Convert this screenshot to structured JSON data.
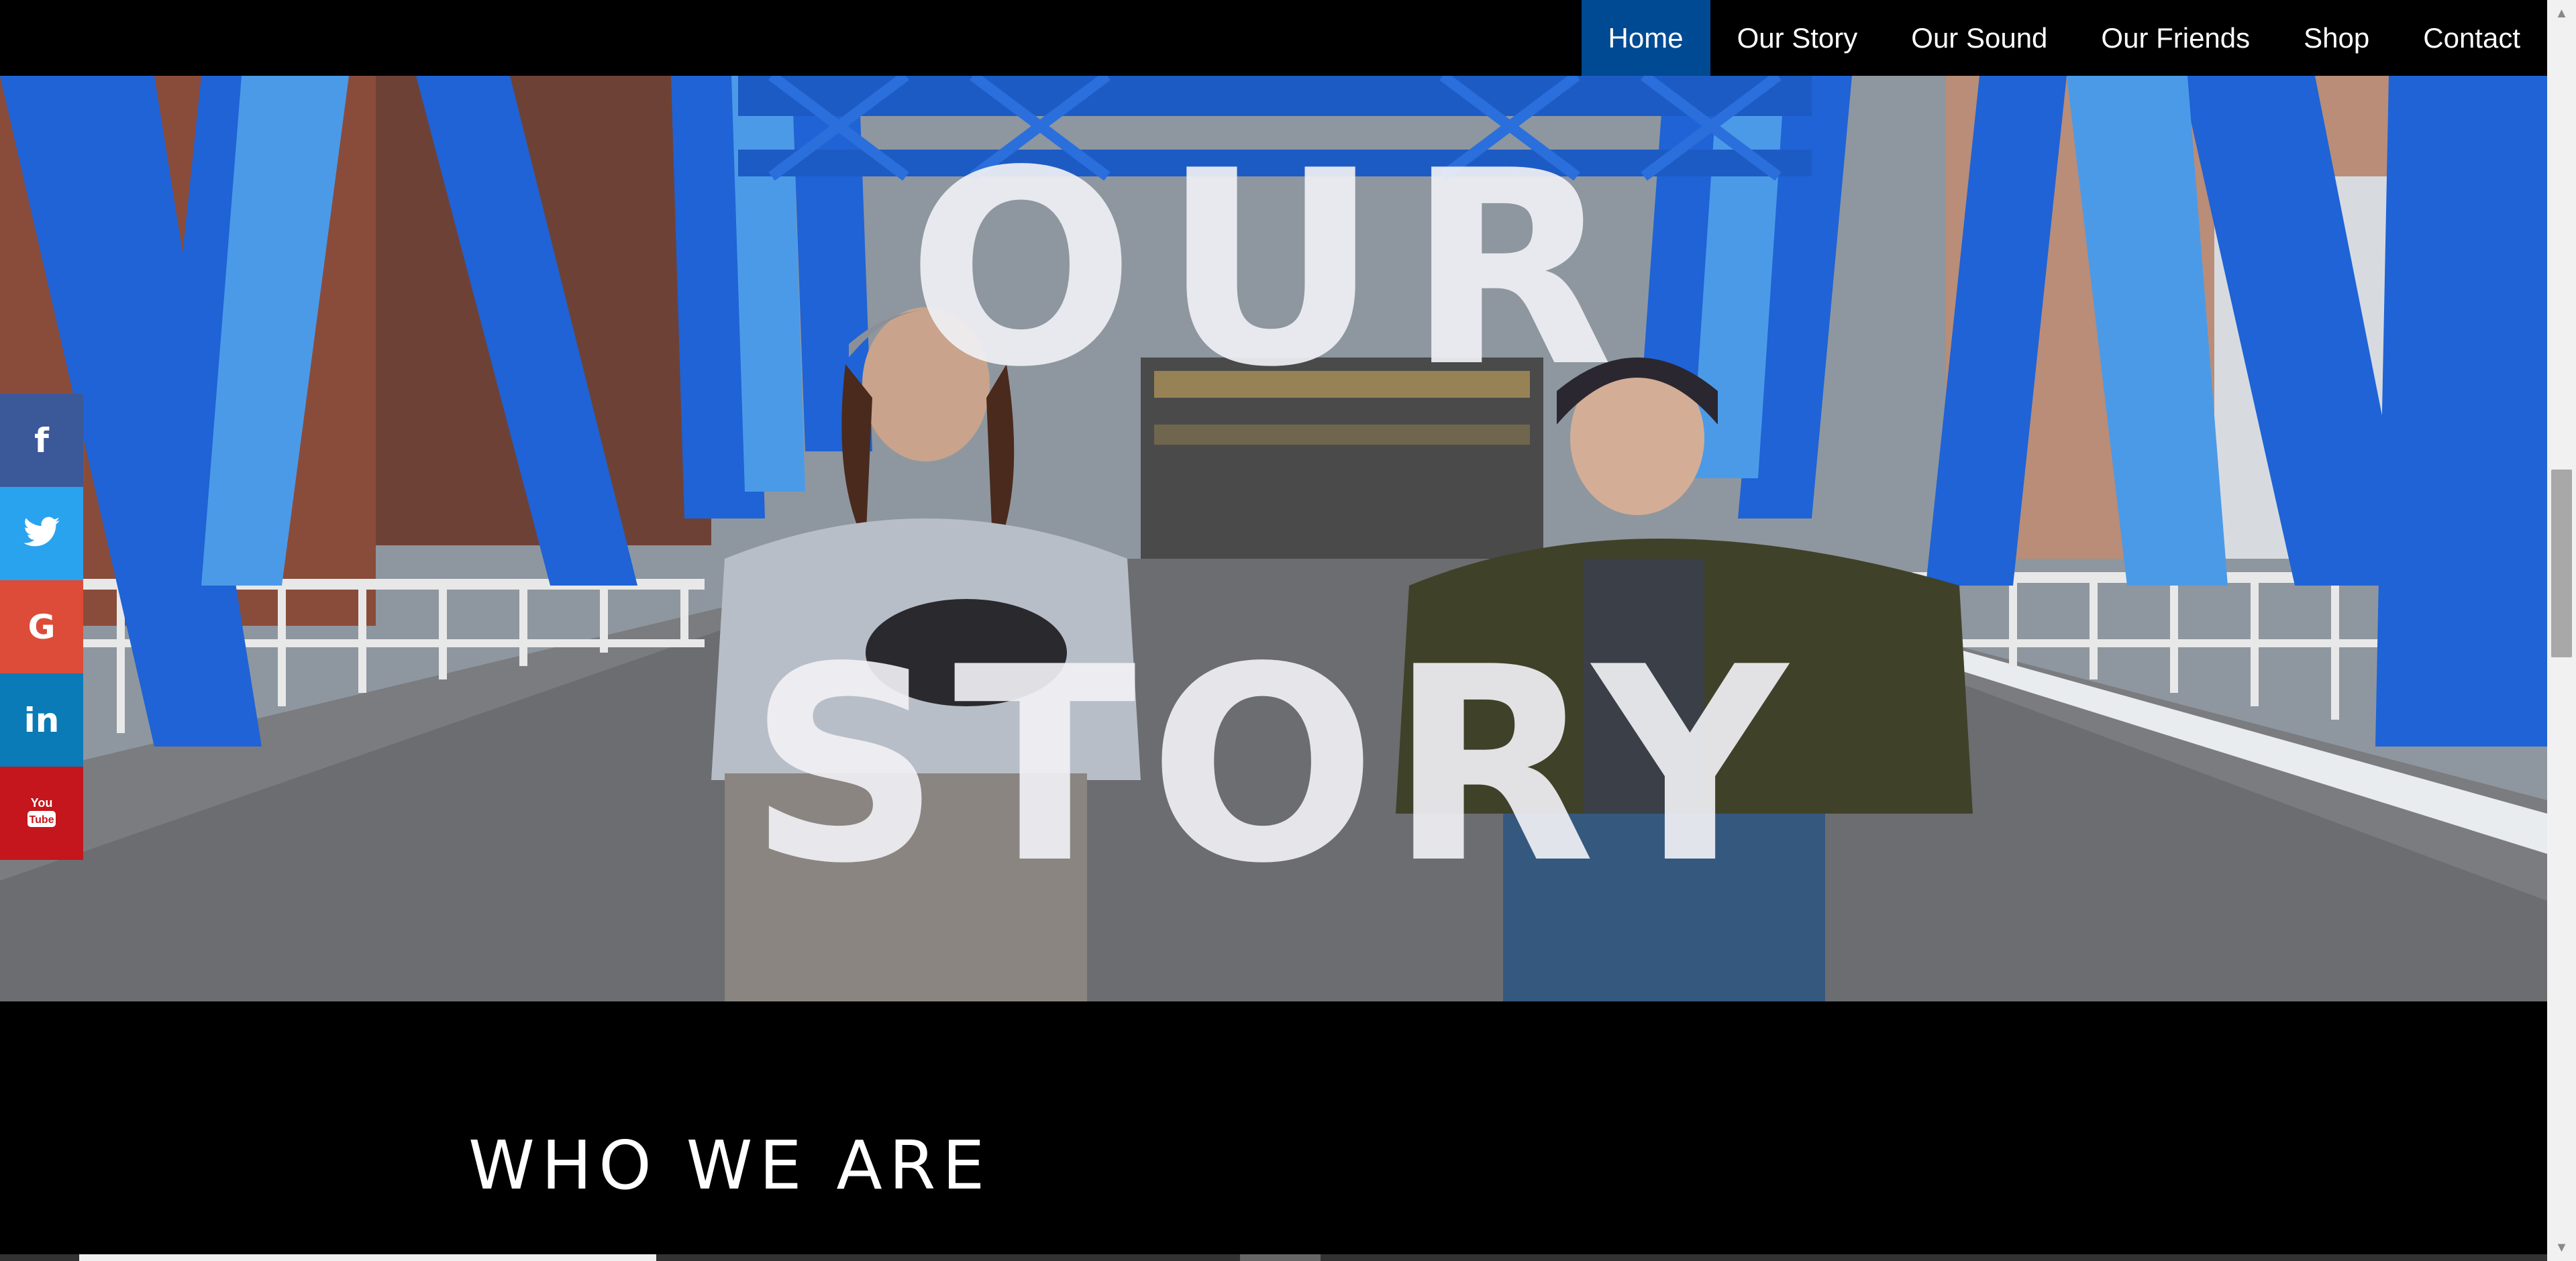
{
  "nav": {
    "items": [
      {
        "label": "Home",
        "active": true
      },
      {
        "label": "Our Story",
        "active": false
      },
      {
        "label": "Our Sound",
        "active": false
      },
      {
        "label": "Our Friends",
        "active": false
      },
      {
        "label": "Shop",
        "active": false
      },
      {
        "label": "Contact",
        "active": false
      }
    ],
    "active_color": "#004a94"
  },
  "hero": {
    "title_line1": "OUR",
    "title_line2": "STORY"
  },
  "social": [
    {
      "icon": "facebook-icon",
      "glyph": "f",
      "color": "#3b5998"
    },
    {
      "icon": "twitter-icon",
      "glyph": "🐦",
      "color": "#2aa3ef"
    },
    {
      "icon": "google-icon",
      "glyph": "G",
      "color": "#dd4b39"
    },
    {
      "icon": "linkedin-icon",
      "glyph": "in",
      "color": "#0a7bb6"
    },
    {
      "icon": "youtube-icon",
      "glyph": "You Tube",
      "color": "#c4161c"
    }
  ],
  "section": {
    "heading": "WHO WE ARE"
  }
}
